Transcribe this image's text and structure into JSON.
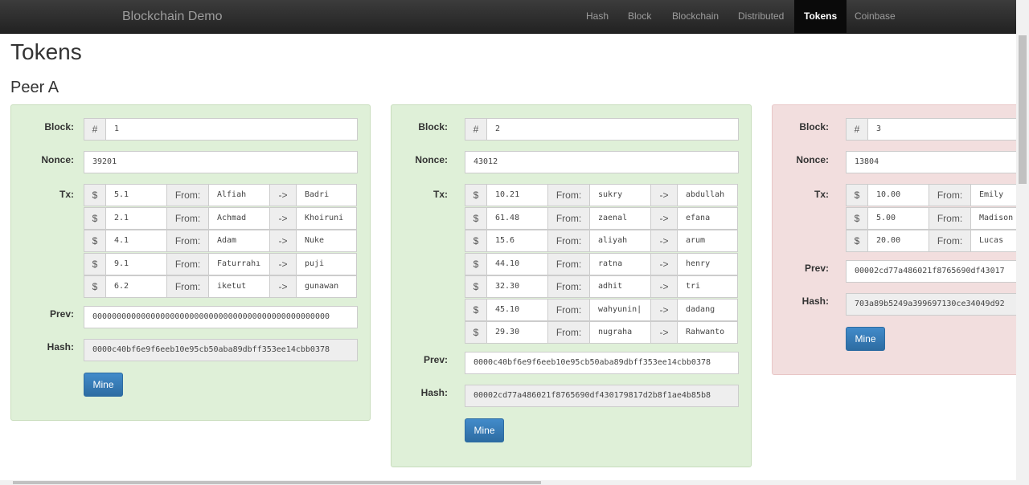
{
  "navbar": {
    "brand": "Blockchain Demo",
    "items": [
      "Hash",
      "Block",
      "Blockchain",
      "Distributed",
      "Tokens",
      "Coinbase"
    ],
    "active": "Tokens"
  },
  "page": {
    "title": "Tokens",
    "peer": "Peer A"
  },
  "labels": {
    "block": "Block:",
    "nonce": "Nonce:",
    "tx": "Tx:",
    "prev": "Prev:",
    "hash": "Hash:",
    "hash_sign": "#",
    "dollar": "$",
    "from": "From:",
    "arrow": "->",
    "mine": "Mine"
  },
  "blocks": [
    {
      "number": "1",
      "nonce": "39201",
      "status": "valid",
      "txs": [
        {
          "amount": "5.1",
          "from": "Alfiah",
          "to": "Badri"
        },
        {
          "amount": "2.1",
          "from": "Achmad",
          "to": "Khoiruni"
        },
        {
          "amount": "4.1",
          "from": "Adam",
          "to": "Nuke"
        },
        {
          "amount": "9.1",
          "from": "Faturrahı",
          "to": "puji"
        },
        {
          "amount": "6.2",
          "from": "iketut",
          "to": "gunawan"
        }
      ],
      "prev": "0000000000000000000000000000000000000000000000000",
      "hash": "0000c40bf6e9f6eeb10e95cb50aba89dbff353ee14cbb0378"
    },
    {
      "number": "2",
      "nonce": "43012",
      "status": "valid",
      "txs": [
        {
          "amount": "10.21",
          "from": "sukry",
          "to": "abdullah"
        },
        {
          "amount": "61.48",
          "from": "zaenal",
          "to": "efana"
        },
        {
          "amount": "15.6",
          "from": "aliyah",
          "to": "arum"
        },
        {
          "amount": "44.10",
          "from": "ratna",
          "to": "henry"
        },
        {
          "amount": "32.30",
          "from": "adhit",
          "to": "tri"
        },
        {
          "amount": "45.10",
          "from": "wahyunin|",
          "to": "dadang"
        },
        {
          "amount": "29.30",
          "from": "nugraha",
          "to": "Rahwanto"
        }
      ],
      "prev": "0000c40bf6e9f6eeb10e95cb50aba89dbff353ee14cbb0378",
      "hash": "00002cd77a486021f8765690df430179817d2b8f1ae4b85b8"
    },
    {
      "number": "3",
      "nonce": "13804",
      "status": "invalid",
      "txs": [
        {
          "amount": "10.00",
          "from": "Emily",
          "to": ""
        },
        {
          "amount": "5.00",
          "from": "Madison",
          "to": ""
        },
        {
          "amount": "20.00",
          "from": "Lucas",
          "to": ""
        }
      ],
      "prev": "00002cd77a486021f8765690df43017",
      "hash": "703a89b5249a399697130ce34049d92"
    }
  ]
}
